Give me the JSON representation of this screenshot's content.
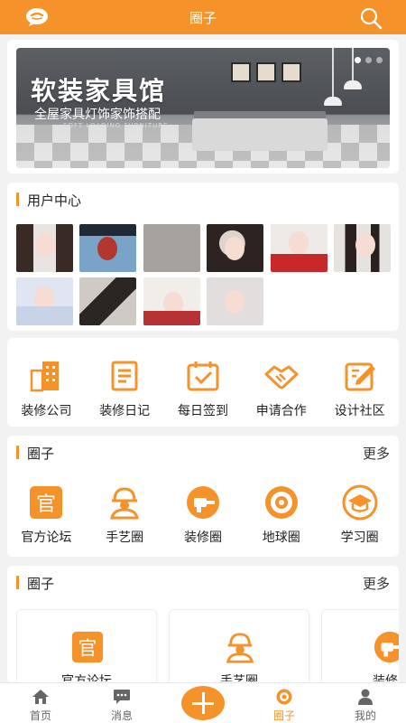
{
  "header": {
    "title": "圈子",
    "left_icon": "chat-bubble-icon",
    "right_icon": "search-icon"
  },
  "banner": {
    "headline": "软装家具馆",
    "subline": "全屋家具灯饰家饰搭配",
    "small_text": "SOFT LOADING FURNITURE",
    "slides": 3,
    "active_slide": 1
  },
  "user_center": {
    "title": "用户中心",
    "avatars": [
      "user-avatar-1",
      "user-avatar-2",
      "user-avatar-3",
      "user-avatar-4",
      "user-avatar-5",
      "user-avatar-6",
      "user-avatar-7",
      "user-avatar-8",
      "user-avatar-9",
      "user-avatar-10"
    ]
  },
  "services": [
    {
      "label": "装修公司",
      "icon": "building-icon"
    },
    {
      "label": "装修日记",
      "icon": "notebook-icon"
    },
    {
      "label": "每日签到",
      "icon": "calendar-check-icon"
    },
    {
      "label": "申请合作",
      "icon": "handshake-icon"
    },
    {
      "label": "设计社区",
      "icon": "pencil-edit-icon"
    }
  ],
  "circles1": {
    "title": "圈子",
    "more": "更多",
    "items": [
      {
        "label": "官方论坛",
        "icon": "official-icon"
      },
      {
        "label": "手艺圈",
        "icon": "worker-icon"
      },
      {
        "label": "装修圈",
        "icon": "drill-icon"
      },
      {
        "label": "地球圈",
        "icon": "target-icon"
      },
      {
        "label": "学习圈",
        "icon": "graduation-cap-icon"
      }
    ]
  },
  "circles2": {
    "title": "圈子",
    "more": "更多",
    "cards": [
      {
        "label": "官方论坛",
        "icon": "official-icon"
      },
      {
        "label": "手艺圈",
        "icon": "worker-icon"
      },
      {
        "label": "装修圈",
        "icon": "drill-icon"
      }
    ]
  },
  "tabbar": [
    {
      "label": "首页",
      "icon": "home-icon"
    },
    {
      "label": "消息",
      "icon": "message-icon"
    },
    {
      "label": "",
      "icon": "plus-icon"
    },
    {
      "label": "圈子",
      "icon": "circle-camera-icon"
    },
    {
      "label": "我的",
      "icon": "user-icon"
    }
  ],
  "colors": {
    "accent": "#f5922a",
    "background": "#f2f2f2"
  }
}
